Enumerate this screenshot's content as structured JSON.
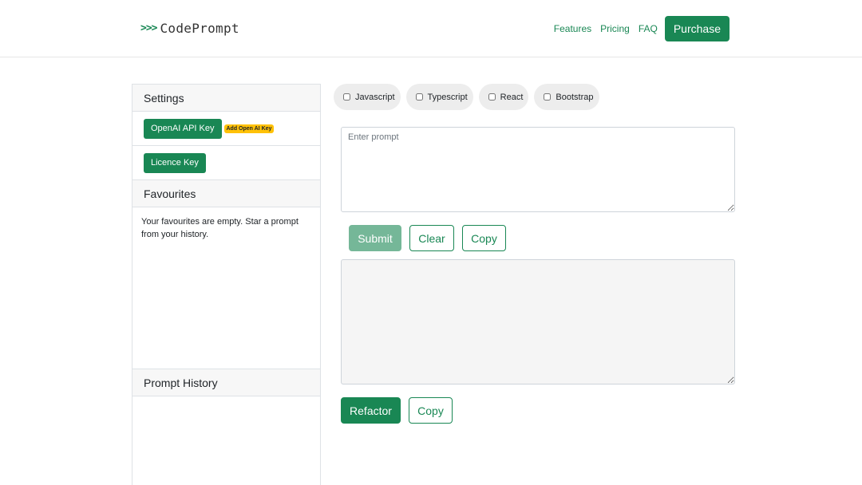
{
  "brand": {
    "icon": ">>>",
    "name": "CodePrompt"
  },
  "nav": {
    "links": [
      "Features",
      "Pricing",
      "FAQ"
    ],
    "purchase_label": "Purchase"
  },
  "sidebar": {
    "settings": {
      "title": "Settings",
      "api_key_label": "OpenAI API Key",
      "api_key_badge": "Add Open AI Key",
      "licence_key_label": "Licence Key"
    },
    "favourites": {
      "title": "Favourites",
      "empty_text": "Your favourites are empty. Star a prompt from your history."
    },
    "history": {
      "title": "Prompt History"
    }
  },
  "options": [
    {
      "label": "Javascript",
      "checked": false
    },
    {
      "label": "Typescript",
      "checked": false
    },
    {
      "label": "React",
      "checked": false
    },
    {
      "label": "Bootstrap",
      "checked": false
    }
  ],
  "prompt": {
    "placeholder": "Enter prompt",
    "value": ""
  },
  "prompt_actions": {
    "submit": "Submit",
    "clear": "Clear",
    "copy": "Copy"
  },
  "output": {
    "value": ""
  },
  "output_actions": {
    "refactor": "Refactor",
    "copy": "Copy"
  },
  "colors": {
    "accent": "#198754",
    "accent_disabled": "#75b798",
    "badge": "#ffc107"
  }
}
